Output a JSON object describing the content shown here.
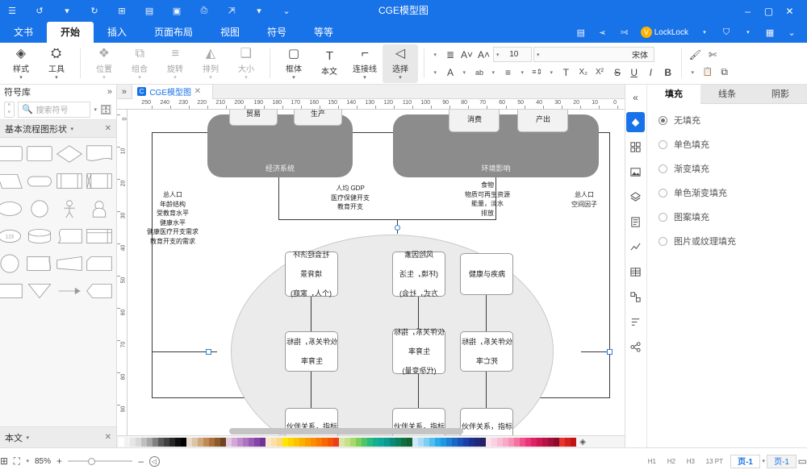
{
  "window": {
    "doc_title": "CGE模型图",
    "controls": {
      "close": "✕",
      "maximize": "▢",
      "minimize": "–"
    },
    "quick_access": [
      {
        "name": "app-menu-icon",
        "glyph": "⌄"
      },
      {
        "name": "grid-icon",
        "glyph": "▦"
      },
      {
        "name": "caret-1",
        "glyph": "▾"
      },
      {
        "name": "shirt-icon",
        "glyph": "⛉"
      },
      {
        "name": "caret-2",
        "glyph": "▾"
      },
      {
        "name": "lockdock-badge",
        "glyph": "V"
      },
      {
        "name": "lockdock-label",
        "glyph": "LockLock"
      },
      {
        "name": "scissors-icon",
        "glyph": "✄"
      },
      {
        "name": "cursor-icon",
        "glyph": "➢"
      },
      {
        "name": "comment-icon",
        "glyph": "▤"
      }
    ],
    "title_right_icons": [
      {
        "name": "help-icon",
        "glyph": "⌄"
      },
      {
        "name": "caret-right",
        "glyph": "▾"
      },
      {
        "name": "share-icon",
        "glyph": "⇱"
      },
      {
        "name": "print-icon",
        "glyph": "⎙"
      },
      {
        "name": "save-icon",
        "glyph": "▣"
      },
      {
        "name": "saveas-icon",
        "glyph": "▤"
      },
      {
        "name": "new-icon",
        "glyph": "⊞"
      },
      {
        "name": "undo-icon",
        "glyph": "↺"
      },
      {
        "name": "caret-undo",
        "glyph": "▾"
      },
      {
        "name": "redo-icon",
        "glyph": "↻"
      },
      {
        "name": "menu-icon",
        "glyph": "☰"
      }
    ]
  },
  "ribbon": {
    "tabs": [
      {
        "label": "文书",
        "active": false
      },
      {
        "label": "开始",
        "active": true
      },
      {
        "label": "插入",
        "active": false
      },
      {
        "label": "页面布局",
        "active": false
      },
      {
        "label": "视图",
        "active": false
      },
      {
        "label": "符号",
        "active": false
      },
      {
        "label": "等等",
        "active": false
      }
    ],
    "groups": [
      {
        "name": "tools",
        "label": "工具",
        "glyph": "⛭",
        "state": "normal"
      },
      {
        "name": "style",
        "label": "样式",
        "glyph": "◈",
        "state": "normal"
      },
      {
        "name": "size",
        "label": "大小",
        "glyph": "❑",
        "state": "dim"
      },
      {
        "name": "arrange",
        "label": "排列",
        "glyph": "◭",
        "state": "dim"
      },
      {
        "name": "rotate",
        "label": "旋转",
        "glyph": "≡",
        "state": "dim"
      },
      {
        "name": "group",
        "label": "组合",
        "glyph": "⧉",
        "state": "dim"
      },
      {
        "name": "position",
        "label": "位置",
        "glyph": "❖",
        "state": "dim"
      },
      {
        "name": "select",
        "label": "选择",
        "glyph": "◁",
        "state": "active"
      },
      {
        "name": "connector",
        "label": "连接线",
        "glyph": "⌐",
        "state": "normal"
      },
      {
        "name": "text",
        "label": "本文",
        "glyph": "T",
        "state": "normal"
      },
      {
        "name": "frame",
        "label": "框体",
        "glyph": "▢",
        "state": "normal"
      }
    ],
    "font": {
      "family": "宋体",
      "size": "10",
      "row1_icons": [
        {
          "name": "text-align-icon",
          "glyph": "≣"
        },
        {
          "name": "shrink-font-icon",
          "glyph": "A˅"
        },
        {
          "name": "grow-font-icon",
          "glyph": "A˄"
        }
      ],
      "row2_icons": [
        {
          "name": "font-color-icon",
          "glyph": "A"
        },
        {
          "name": "highlight-icon",
          "glyph": "ab"
        },
        {
          "name": "align-left-icon",
          "glyph": "≡"
        },
        {
          "name": "line-spacing-icon",
          "glyph": "≡⇕"
        },
        {
          "name": "text-direction-icon",
          "glyph": "T"
        },
        {
          "name": "subscript-icon",
          "glyph": "X₂"
        },
        {
          "name": "superscript-icon",
          "glyph": "X²"
        },
        {
          "name": "strikethrough-icon",
          "glyph": "S"
        },
        {
          "name": "underline-icon",
          "glyph": "U"
        },
        {
          "name": "italic-icon",
          "glyph": "I"
        },
        {
          "name": "bold-icon",
          "glyph": "B"
        }
      ]
    },
    "clipboard": [
      {
        "name": "format-painter-icon",
        "glyph": "🖌"
      },
      {
        "name": "cut-icon",
        "glyph": "✄"
      },
      {
        "name": "paste-icon",
        "glyph": "📋"
      },
      {
        "name": "copy-icon",
        "glyph": "⧉"
      }
    ]
  },
  "format_panel": {
    "tabs": [
      {
        "label": "阴影",
        "active": false
      },
      {
        "label": "线条",
        "active": false
      },
      {
        "label": "填充",
        "active": true
      }
    ],
    "fill_options": [
      {
        "label": "无填充",
        "selected": true
      },
      {
        "label": "单色填充",
        "selected": false
      },
      {
        "label": "渐变填充",
        "selected": false
      },
      {
        "label": "单色渐变填充",
        "selected": false
      },
      {
        "label": "图案填充",
        "selected": false
      },
      {
        "label": "图片或纹理填充",
        "selected": false
      }
    ],
    "rail": {
      "collapse_glyph": "«",
      "buttons": [
        {
          "name": "fill-tool",
          "glyph": "fill",
          "active": true
        },
        {
          "name": "layout-tool",
          "glyph": "grid",
          "active": false
        },
        {
          "name": "image-tool",
          "glyph": "image",
          "active": false
        },
        {
          "name": "layers-tool",
          "glyph": "layers",
          "active": false
        },
        {
          "name": "notes-tool",
          "glyph": "note",
          "active": false
        },
        {
          "name": "chart-tool",
          "glyph": "chart",
          "active": false
        },
        {
          "name": "table-tool",
          "glyph": "table",
          "active": false
        },
        {
          "name": "plugin-tool",
          "glyph": "plugin",
          "active": false
        },
        {
          "name": "list-tool",
          "glyph": "list",
          "active": false
        },
        {
          "name": "share-tool",
          "glyph": "share",
          "active": false
        }
      ]
    }
  },
  "shapes_panel": {
    "title": "符号库",
    "expand_glyph": "»",
    "close_glyph": "✕",
    "search_placeholder": "搜索符号",
    "library_icon": "🗄",
    "section_title": "基本流程图形状",
    "section_close": "✕",
    "section_caret": "▾",
    "footer_title": "本文",
    "footer_caret": "▾",
    "footer_close": "✕",
    "shapes": [
      "document",
      "diamond",
      "rect",
      "rounded-rect",
      "predefined-process",
      "internal-storage",
      "terminator",
      "parallelogram",
      "user",
      "actor",
      "circle",
      "ellipse",
      "card",
      "wave-doc",
      "cylinder",
      "tape-ellipse",
      "corner-doc",
      "trapezoid-right",
      "tape",
      "circle2",
      "pentagon",
      "arrow-line",
      "funnel",
      "stripe"
    ]
  },
  "canvas": {
    "doc_tab": {
      "label": "CGE模型图",
      "icon": "C",
      "close": "✕"
    },
    "more_glyph": "»",
    "ruler_h_ticks": [
      "0",
      "10",
      "20",
      "30",
      "40",
      "50",
      "60",
      "70",
      "80",
      "90",
      "100",
      "110",
      "120",
      "130",
      "140",
      "150",
      "160",
      "170",
      "180",
      "190",
      "200",
      "210",
      "220",
      "230",
      "240",
      "250"
    ],
    "ruler_v_ticks": [
      "0",
      "10",
      "20",
      "30",
      "40",
      "50",
      "60",
      "70",
      "80",
      "90"
    ],
    "palette_colors": [
      "#ffffff",
      "#f2f2f2",
      "#e6e6e6",
      "#d9d9d9",
      "#bfbfbf",
      "#a6a6a6",
      "#808080",
      "#595959",
      "#404040",
      "#262626",
      "#0d0d0d",
      "#000000",
      "#e8d9c8",
      "#dcc4a8",
      "#cfa87d",
      "#c08a55",
      "#a9703d",
      "#8c5a2b",
      "#6e4420",
      "#e3c8e0",
      "#d3a8d6",
      "#c08ccb",
      "#ae74c0",
      "#9a5bb4",
      "#8645a6",
      "#6f3596",
      "#fbe8c8",
      "#fbe0a8",
      "#fcd885",
      "#ffe600",
      "#fdd400",
      "#fcc200",
      "#fbb000",
      "#fa9e00",
      "#f98c00",
      "#f87a00",
      "#f76800",
      "#f45500",
      "#ef3d1f",
      "#d9e6a8",
      "#c8e08a",
      "#a8d96b",
      "#7ecf57",
      "#4ec46b",
      "#27bb7e",
      "#12b08e",
      "#0fa79b",
      "#0b9a90",
      "#0a8a7a",
      "#0c7f5c",
      "#0e7040",
      "#136232",
      "#cfe8f7",
      "#a8dcf5",
      "#7fcdf2",
      "#54bdee",
      "#2aaaea",
      "#1f96e0",
      "#1b80d4",
      "#1a68c6",
      "#1a52b8",
      "#1b3fa8",
      "#1d3090",
      "#202878",
      "#242264",
      "#fbe0ee",
      "#fad0e2",
      "#f9bed6",
      "#f8a8c6",
      "#f790b4",
      "#f670a0",
      "#f2508c",
      "#ea3578",
      "#de2166",
      "#cc1753",
      "#b81244",
      "#a20e38",
      "#8c0b2d",
      "#e8342d",
      "#d42020",
      "#c11414"
    ]
  },
  "diagram": {
    "groups": [
      {
        "name": "environment-group",
        "label": "环境影响"
      },
      {
        "name": "economy-group",
        "label": "经济系统"
      }
    ],
    "group_nodes": [
      {
        "label": "产出"
      },
      {
        "label": "消费"
      },
      {
        "label": "生产"
      },
      {
        "label": "贸易"
      }
    ],
    "flow_labels": [
      {
        "name": "env-flow-label",
        "lines": [
          "食物",
          "物质可再生资源",
          "能量，淡水",
          "排放"
        ]
      },
      {
        "name": "econ-flow-label",
        "lines": [
          "人均 GDP",
          "医疗保健开支",
          "教育开支"
        ]
      }
    ],
    "side_labels": [
      {
        "name": "left-side-label",
        "lines": [
          "总人口",
          "空间因子"
        ]
      },
      {
        "name": "right-side-label",
        "lines": [
          "总人口",
          "年龄结构",
          "受教育水平",
          "健康水平",
          "健康医疗开支需求",
          "教育开支的需求"
        ]
      }
    ],
    "row1_nodes": [
      {
        "lines": [
          "健康与疾病"
        ]
      },
      {
        "lines": [
          "风险因素",
          "(环境，生活",
          "方式，社会)"
        ]
      },
      {
        "lines": [
          "社会经济环",
          "境背景",
          "(个人，家庭)"
        ]
      }
    ],
    "row2_nodes": [
      {
        "lines": [
          "伙伴关系，指标",
          "死亡率"
        ]
      },
      {
        "lines": [
          "伙伴关系，指标",
          "生育率",
          "(代孕变量)"
        ]
      },
      {
        "lines": [
          "伙伴关系，指标",
          "生育率"
        ]
      }
    ],
    "row3_nodes": [
      {
        "lines": [
          "伙伴关系，指标"
        ]
      },
      {
        "lines": [
          "伙伴关系，指标"
        ]
      },
      {
        "lines": [
          "伙伴关系，指标"
        ]
      }
    ]
  },
  "status": {
    "fit_page_icon": "⊞",
    "fit_width_icon": "⛶",
    "zoom_caret": "▾",
    "zoom_level": "85%",
    "zoom_in": "+",
    "zoom_out": "–",
    "zoom_reset_icon": "◁",
    "page_tabs": [
      {
        "label": "页-1",
        "selected": true
      },
      {
        "label": "页-1",
        "selected": false
      }
    ],
    "page_caret": "▾",
    "page_view_icon": "▭",
    "headers": [
      "H1",
      "H2",
      "H3",
      "13 PT"
    ]
  }
}
